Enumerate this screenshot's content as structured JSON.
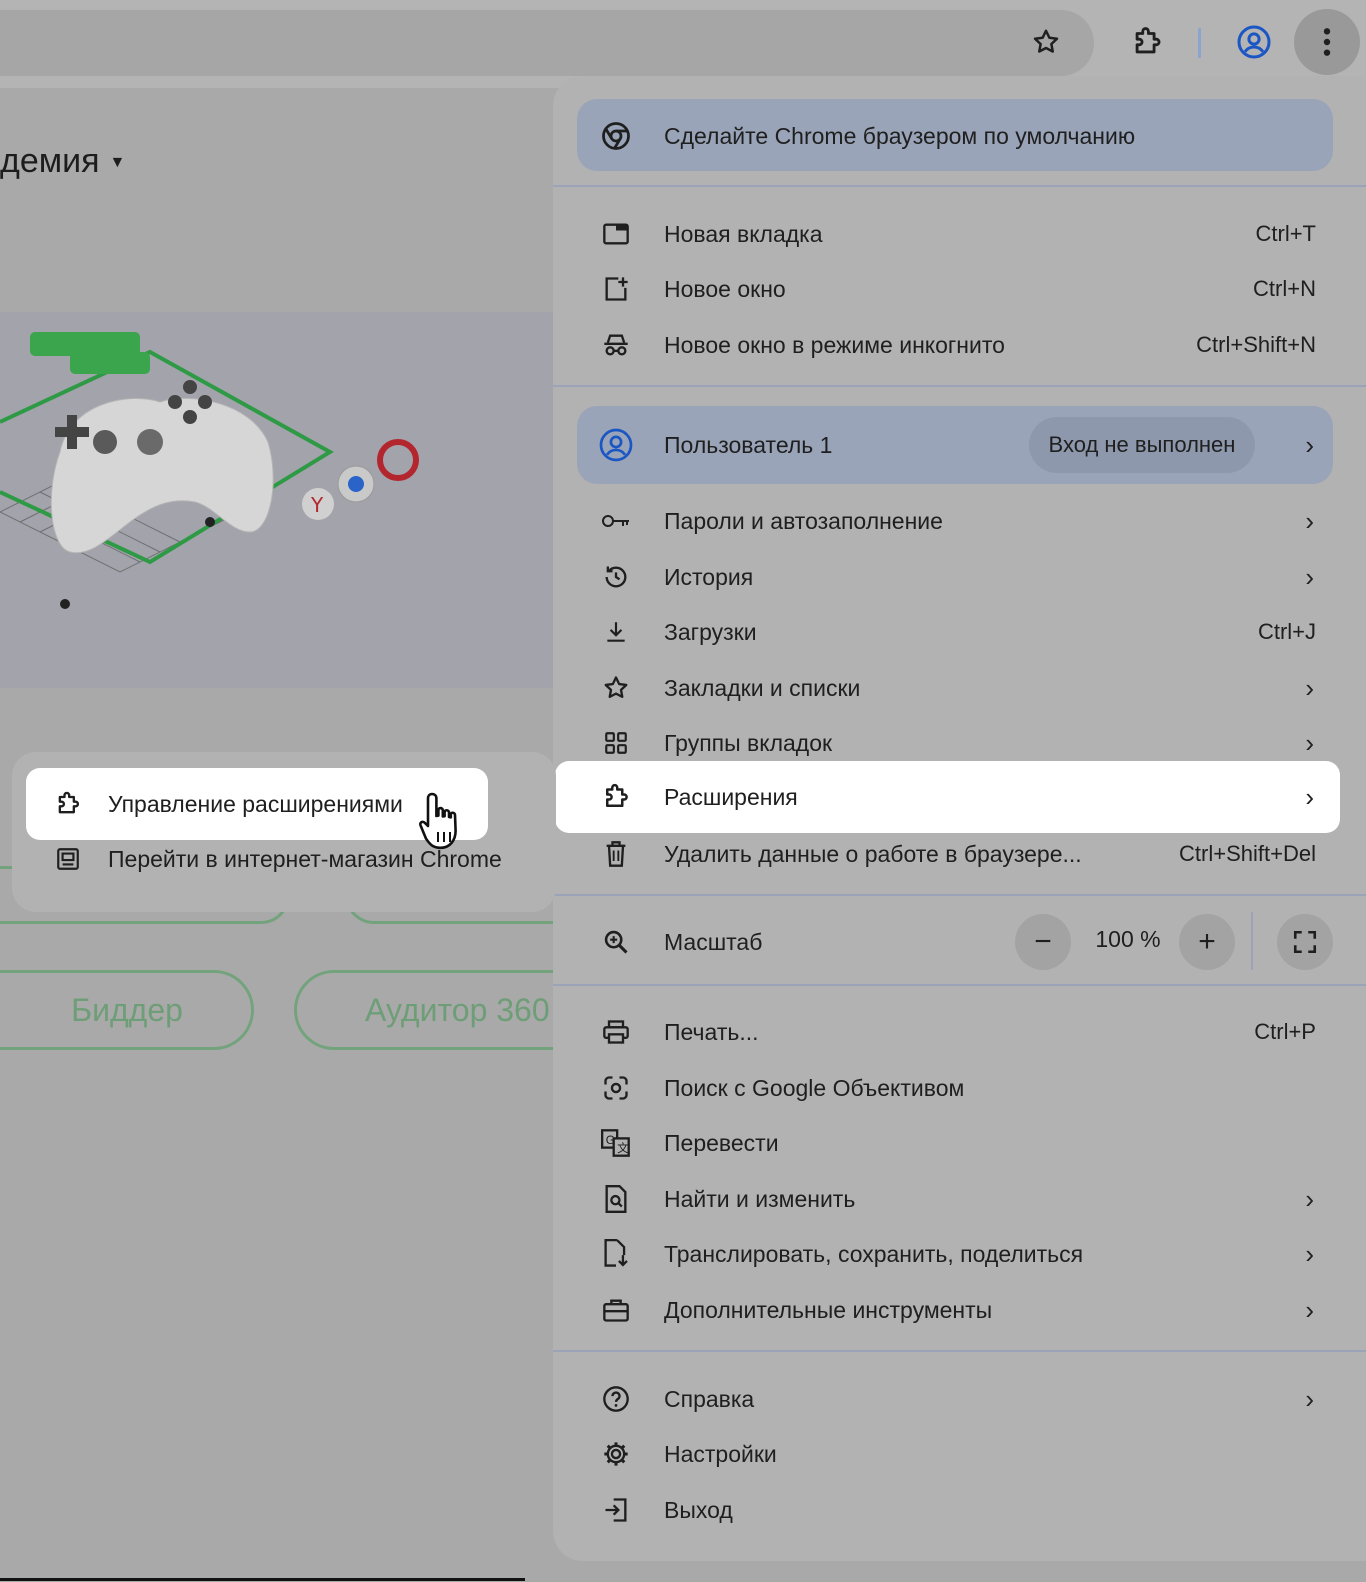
{
  "page": {
    "heading": "демия",
    "pills": [
      "Биддер",
      "Аудитор 360"
    ]
  },
  "menu": {
    "default_banner": "Сделайте Chrome браузером по умолчанию",
    "items_top": [
      {
        "label": "Новая вкладка",
        "shortcut": "Ctrl+T"
      },
      {
        "label": "Новое окно",
        "shortcut": "Ctrl+N"
      },
      {
        "label": "Новое окно в режиме инкогнито",
        "shortcut": "Ctrl+Shift+N"
      }
    ],
    "profile": {
      "label": "Пользователь 1",
      "status": "Вход не выполнен"
    },
    "items_mid": [
      {
        "label": "Пароли и автозаполнение",
        "shortcut": ""
      },
      {
        "label": "История",
        "shortcut": ""
      },
      {
        "label": "Загрузки",
        "shortcut": "Ctrl+J"
      },
      {
        "label": "Закладки и списки",
        "shortcut": ""
      },
      {
        "label": "Группы вкладок",
        "shortcut": ""
      },
      {
        "label": "Расширения",
        "shortcut": ""
      },
      {
        "label": "Удалить данные о работе в браузере...",
        "shortcut": "Ctrl+Shift+Del"
      }
    ],
    "zoom": {
      "label": "Масштаб",
      "value": "100 %",
      "minus": "−",
      "plus": "+"
    },
    "items_tools": [
      {
        "label": "Печать...",
        "shortcut": "Ctrl+P"
      },
      {
        "label": "Поиск с Google Объективом",
        "shortcut": ""
      },
      {
        "label": "Перевести",
        "shortcut": ""
      },
      {
        "label": "Найти и изменить",
        "shortcut": ""
      },
      {
        "label": "Транслировать, сохранить, поделиться",
        "shortcut": ""
      },
      {
        "label": "Дополнительные инструменты",
        "shortcut": ""
      }
    ],
    "items_bottom": [
      {
        "label": "Справка"
      },
      {
        "label": "Настройки"
      },
      {
        "label": "Выход"
      }
    ],
    "chevron": "›"
  },
  "submenu": {
    "items": [
      {
        "label": "Управление расширениями"
      },
      {
        "label": "Перейти в интернет-магазин Chrome"
      }
    ]
  },
  "colors": {
    "accent_profile": "#1a56c4"
  }
}
